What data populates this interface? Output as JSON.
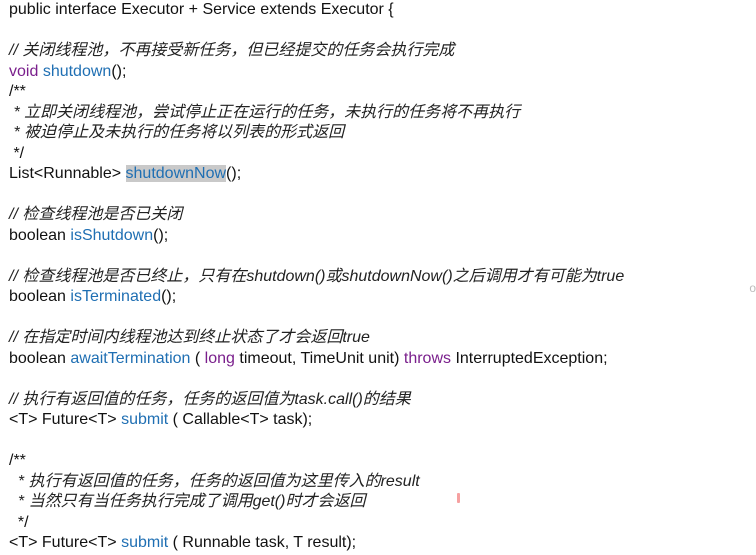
{
  "code": {
    "line1": {
      "text": "public interface Executor + Service extends Executor {"
    },
    "line2": {
      "text": ""
    },
    "line3": {
      "comment": "// 关闭线程池，不再接受新任务，但已经提交的任务会执行完成"
    },
    "line4": {
      "kw": "void",
      "fn": "shutdown",
      "rest": "();"
    },
    "line5": {
      "text": "/**"
    },
    "line6": {
      "comment": " * 立即关闭线程池，尝试停止正在运行的任务，未执行的任务将不再执行"
    },
    "line7": {
      "comment": " * 被迫停止及未执行的任务将以列表的形式返回"
    },
    "line8": {
      "text": " */"
    },
    "line9": {
      "pre": "List<Runnable> ",
      "fn": "shutdownNow",
      "rest": "();"
    },
    "line10": {
      "text": ""
    },
    "line11": {
      "comment": "// 检查线程池是否已关闭"
    },
    "line12": {
      "pre": "boolean ",
      "fn": "isShutdown",
      "rest": "();"
    },
    "line13": {
      "text": ""
    },
    "line14": {
      "comment": "// 检查线程池是否已终止，只有在shutdown()或shutdownNow()之后调用才有可能为true"
    },
    "line15": {
      "pre": "boolean ",
      "fn": "isTerminated",
      "rest": "();"
    },
    "line16": {
      "text": ""
    },
    "line17": {
      "comment": "// 在指定时间内线程池达到终止状态了才会返回true"
    },
    "line18": {
      "pre": "boolean ",
      "fn": "awaitTermination",
      "mid1": " ( ",
      "kw1": "long",
      "mid2": " timeout, TimeUnit unit) ",
      "kw2": "throws",
      "rest": " InterruptedException;"
    },
    "line19": {
      "text": ""
    },
    "line20": {
      "comment": "// 执行有返回值的任务，任务的返回值为task.call()的结果"
    },
    "line21": {
      "pre": "<T> Future<T> ",
      "fn": "submit",
      "rest": " ( Callable<T> task);"
    },
    "line22": {
      "text": ""
    },
    "line23": {
      "text": "/**"
    },
    "line24": {
      "comment": "  * 执行有返回值的任务，任务的返回值为这里传入的result"
    },
    "line25": {
      "comment": "  * 当然只有当任务执行完成了调用get()时才会返回"
    },
    "line26": {
      "text": "  */"
    },
    "line27": {
      "pre": "<T> Future<T> ",
      "fn": "submit",
      "rest": " ( Runnable task, T result);"
    }
  },
  "edge_glyph": "o"
}
